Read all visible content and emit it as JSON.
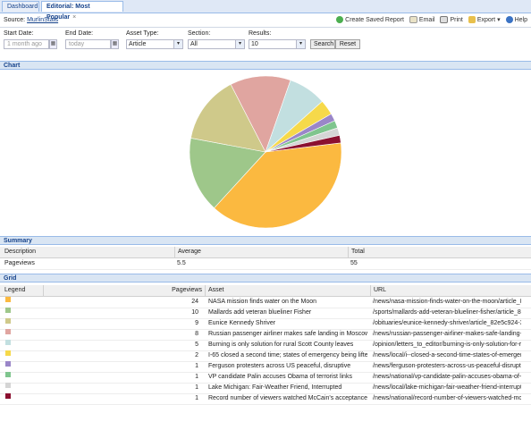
{
  "tabs": [
    {
      "label": "Dashboard"
    },
    {
      "label": "Editorial: Most Popular"
    }
  ],
  "source": {
    "label": "Source:",
    "link": "MurlinStats"
  },
  "actions": [
    "Create Saved Report",
    "Email",
    "Print",
    "Export",
    "Help"
  ],
  "filters": {
    "start_label": "Start Date:",
    "start_placeholder": "1 month ago",
    "end_label": "End Date:",
    "end_placeholder": "today",
    "asset_label": "Asset Type:",
    "asset_value": "Article",
    "section_label": "Section:",
    "section_value": "All",
    "results_label": "Results:",
    "results_value": "10",
    "search": "Search",
    "reset": "Reset"
  },
  "panels": {
    "chart": "Chart",
    "summary": "Summary",
    "grid": "Grid"
  },
  "chart_data": {
    "type": "pie",
    "values": [
      24,
      10,
      9,
      8,
      5,
      2,
      1,
      1,
      1,
      1,
      1
    ],
    "colors": [
      "#fbb940",
      "#9ec78a",
      "#cfc98a",
      "#e0a5a0",
      "#c2dfe0",
      "#f6d94a",
      "#9a86c8",
      "#7fc58e",
      "#d5d5d5",
      "#8b1030",
      "#fbb940"
    ]
  },
  "summary": {
    "headers": [
      "Description",
      "Average",
      "Total"
    ],
    "row": [
      "Pageviews",
      "5.5",
      "55"
    ]
  },
  "grid": {
    "headers": [
      "Legend",
      "Pageviews",
      "Asset",
      "URL"
    ],
    "rows": [
      {
        "color": "#fbb940",
        "pv": "24",
        "asset": "NASA mission finds water on the Moon",
        "url": "/news/nasa-mission-finds-water-on-the-moon/article_8..."
      },
      {
        "color": "#9ec78a",
        "pv": "10",
        "asset": "Mallards add veteran blueliner Fisher",
        "url": "/sports/mallards-add-veteran-blueliner-fisher/article_82..."
      },
      {
        "color": "#cfc98a",
        "pv": "9",
        "asset": "Eunice Kennedy Shriver",
        "url": "/obituaries/eunice-kennedy-shriver/article_82e5c924-3..."
      },
      {
        "color": "#e0a5a0",
        "pv": "8",
        "asset": "Russian passenger airliner makes safe landing in Moscow af...",
        "url": "/news/russian-passenger-airliner-makes-safe-landing-i..."
      },
      {
        "color": "#c2dfe0",
        "pv": "5",
        "asset": "Burning is only solution for rural Scott County leaves",
        "url": "/opinion/letters_to_editor/burning-is-only-solution-for-ru..."
      },
      {
        "color": "#f6d94a",
        "pv": "2",
        "asset": "I-65 closed a second time; states of emergency being lifted",
        "url": "/news/local/i--closed-a-second-time-states-of-emergen..."
      },
      {
        "color": "#9a86c8",
        "pv": "1",
        "asset": "Ferguson protesters across US peaceful, disruptive",
        "url": "/news/ferguson-protesters-across-us-peaceful-disrupti..."
      },
      {
        "color": "#7fc58e",
        "pv": "1",
        "asset": "VP candidate Palin accuses Obama of terrorist links",
        "url": "/news/national/vp-candidate-palin-accuses-obama-of-t..."
      },
      {
        "color": "#d5d5d5",
        "pv": "1",
        "asset": "Lake Michigan: Fair-Weather Friend, Interrupted",
        "url": "/news/local/lake-michigan-fair-weather-friend-interrupte..."
      },
      {
        "color": "#8b1030",
        "pv": "1",
        "asset": "Record number of viewers watched McCain's acceptance sp...",
        "url": "/news/national/record-number-of-viewers-watched-mc..."
      }
    ]
  }
}
